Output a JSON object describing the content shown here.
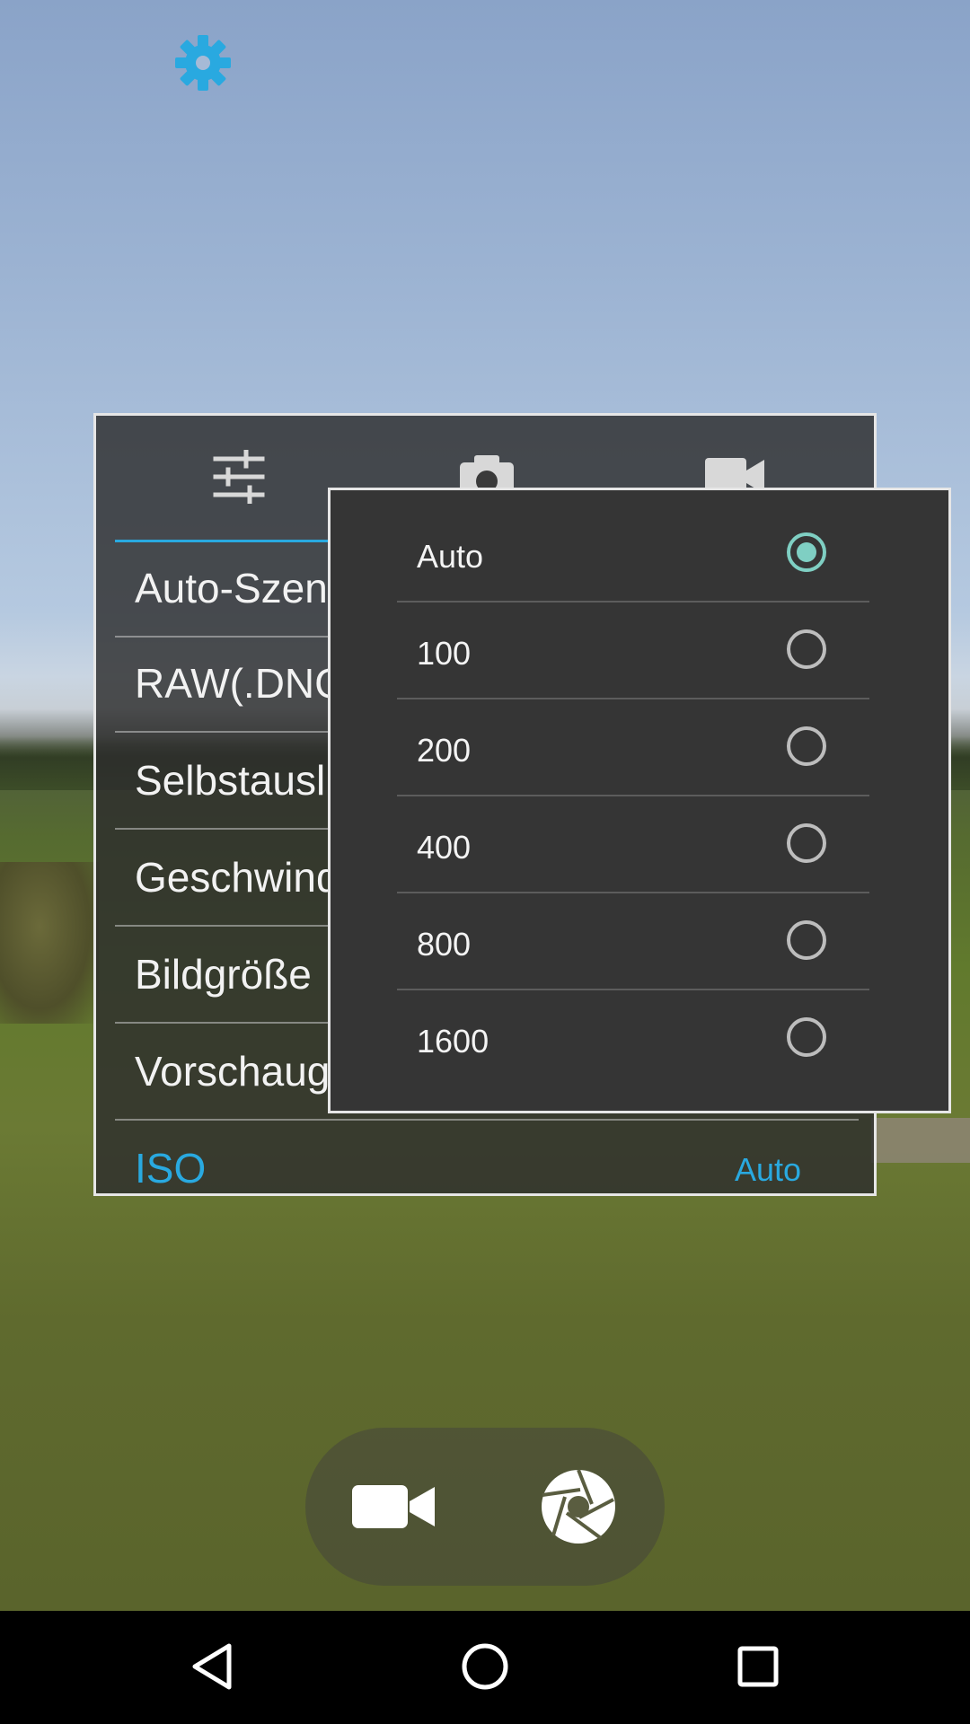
{
  "top_bar": {
    "settings_icon": "gear-icon",
    "accent_color": "#29a9e0"
  },
  "settings_panel": {
    "tabs": [
      {
        "icon": "sliders-icon"
      },
      {
        "icon": "camera-icon"
      },
      {
        "icon": "video-camera-icon"
      }
    ],
    "rows": [
      {
        "label": "Auto-Szene"
      },
      {
        "label": "RAW(.DNG"
      },
      {
        "label": "Selbstausl"
      },
      {
        "label": "Geschwind"
      },
      {
        "label": "Bildgröße"
      },
      {
        "label": "Vorschaug"
      }
    ],
    "iso": {
      "label": "ISO",
      "value": "Auto"
    }
  },
  "iso_dropdown": {
    "options": [
      "Auto",
      "100",
      "200",
      "400",
      "800",
      "1600"
    ],
    "selected": "Auto",
    "selected_color": "#7fcfc3"
  },
  "capture_controls": {
    "video_icon": "video-camera-icon",
    "shutter_icon": "shutter-icon"
  },
  "navbar": {
    "back_icon": "back-icon",
    "home_icon": "home-icon",
    "recents_icon": "recents-icon"
  }
}
